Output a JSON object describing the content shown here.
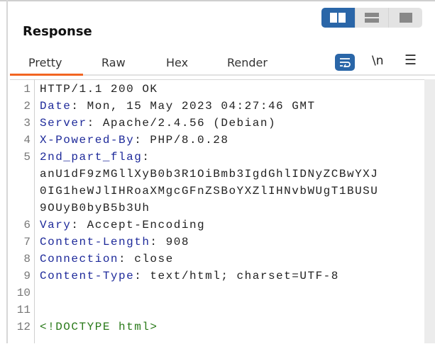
{
  "panel": {
    "title": "Response"
  },
  "layout_toggle": {
    "options": [
      "side-by-side-icon",
      "stacked-icon",
      "single-pane-icon"
    ],
    "selected": 0,
    "accent": "#2a66a8"
  },
  "tabs": [
    {
      "label": "Pretty",
      "active": true
    },
    {
      "label": "Raw"
    },
    {
      "label": "Hex"
    },
    {
      "label": "Render"
    }
  ],
  "toolbar": {
    "wrap_icon": "word-wrap-icon",
    "newline_label": "\\n",
    "menu_icon": "hamburger-icon"
  },
  "accent_tab": "#f26522",
  "lines": [
    {
      "n": "1",
      "key": "",
      "sep": "",
      "val": "HTTP/1.1 200 OK"
    },
    {
      "n": "2",
      "key": "Date",
      "sep": ":",
      "val": " Mon, 15 May 2023 04:27:46 GMT"
    },
    {
      "n": "3",
      "key": "Server",
      "sep": ":",
      "val": " Apache/2.4.56 (Debian)"
    },
    {
      "n": "4",
      "key": "X-Powered-By",
      "sep": ":",
      "val": " PHP/8.0.28"
    },
    {
      "n": "5",
      "key": "2nd_part_flag",
      "sep": ":",
      "val": ""
    },
    {
      "n": "",
      "key": "",
      "sep": "",
      "val": "anU1dF9zMGllXyB0b3R1OiBmb3IgdGhlIDNyZCBwYXJ"
    },
    {
      "n": "",
      "key": "",
      "sep": "",
      "val": "0IG1heWJlIHRoaXMgcGFnZSBoYXZlIHNvbWUgT1BUSU"
    },
    {
      "n": "",
      "key": "",
      "sep": "",
      "val": "9OUyB0byB5b3Uh"
    },
    {
      "n": "6",
      "key": "Vary",
      "sep": ":",
      "val": " Accept-Encoding"
    },
    {
      "n": "7",
      "key": "Content-Length",
      "sep": ":",
      "val": " 908"
    },
    {
      "n": "8",
      "key": "Connection",
      "sep": ":",
      "val": " close"
    },
    {
      "n": "9",
      "key": "Content-Type",
      "sep": ":",
      "val": " text/html; charset=UTF-8"
    },
    {
      "n": "10",
      "key": "",
      "sep": "",
      "val": ""
    },
    {
      "n": "11",
      "key": "",
      "sep": "",
      "val": ""
    },
    {
      "n": "12",
      "key": "",
      "sep": "",
      "val": "",
      "html": "<!DOCTYPE html>"
    }
  ]
}
